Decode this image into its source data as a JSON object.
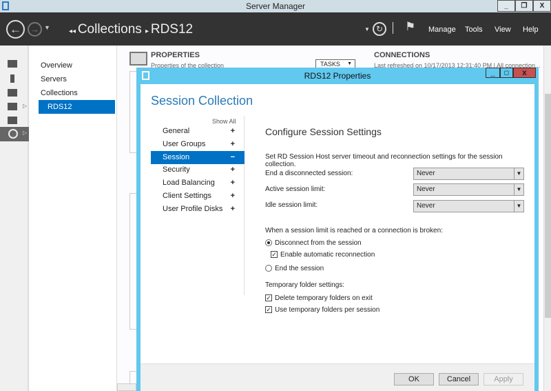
{
  "window": {
    "title": "Server Manager",
    "minimize": "_",
    "restore": "❐",
    "close": "X"
  },
  "header": {
    "breadcrumb_root": "Collections",
    "breadcrumb_current": "RDS12",
    "menu": [
      "Manage",
      "Tools",
      "View",
      "Help"
    ]
  },
  "nav": {
    "items": [
      "Overview",
      "Servers",
      "Collections",
      "RDS12"
    ],
    "selected": "RDS12"
  },
  "content": {
    "properties_title": "PROPERTIES",
    "properties_subtitle": "Properties of the collection",
    "tasks_label": "TASKS",
    "connections_title": "CONNECTIONS",
    "connections_subtitle": "Last refreshed on 10/17/2013 12:31:40 PM | All connection..."
  },
  "dialog": {
    "title": "RDS12 Properties",
    "heading": "Session Collection",
    "show_all": "Show All",
    "sections": [
      {
        "label": "General",
        "sign": "+"
      },
      {
        "label": "User Groups",
        "sign": "+"
      },
      {
        "label": "Session",
        "sign": "−",
        "selected": true
      },
      {
        "label": "Security",
        "sign": "+"
      },
      {
        "label": "Load Balancing",
        "sign": "+"
      },
      {
        "label": "Client Settings",
        "sign": "+"
      },
      {
        "label": "User Profile Disks",
        "sign": "+"
      }
    ],
    "panel_title": "Configure Session Settings",
    "description": "Set RD Session Host server timeout and reconnection settings for the session collection.",
    "fields": [
      {
        "label": "End a disconnected session:",
        "value": "Never"
      },
      {
        "label": "Active session limit:",
        "value": "Never"
      },
      {
        "label": "Idle session limit:",
        "value": "Never"
      }
    ],
    "limit_prompt": "When a session limit is reached or a connection is broken:",
    "radio_disconnect": {
      "label": "Disconnect from the session",
      "selected": true
    },
    "check_reconnect": {
      "label": "Enable automatic reconnection",
      "checked": true
    },
    "radio_end": {
      "label": "End the session",
      "selected": false
    },
    "temp_title": "Temporary folder settings:",
    "check_delete": {
      "label": "Delete temporary folders on exit",
      "checked": true
    },
    "check_per_session": {
      "label": "Use temporary folders per session",
      "checked": true
    },
    "buttons": {
      "ok": "OK",
      "cancel": "Cancel",
      "apply": "Apply"
    }
  },
  "colors": {
    "accent": "#0072c6",
    "dialog_frame": "#61c8ef",
    "header": "#333333",
    "close": "#c75050"
  }
}
